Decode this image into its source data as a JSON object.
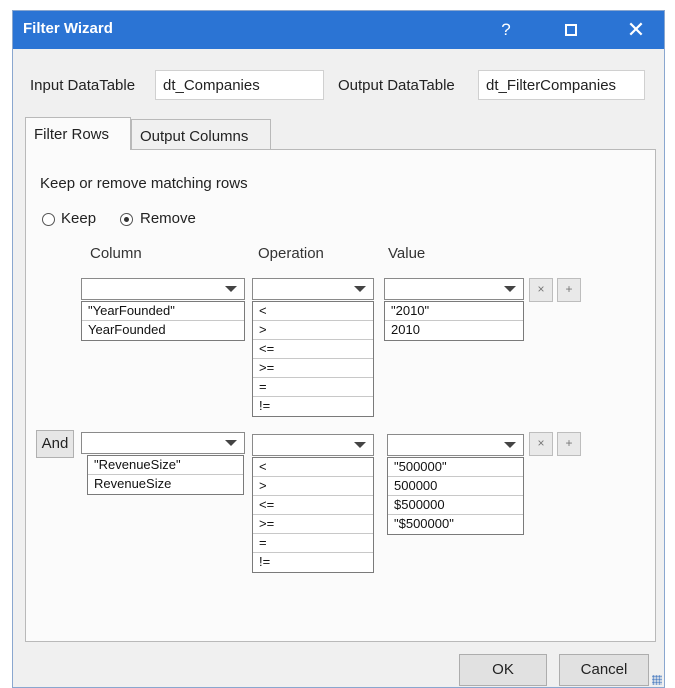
{
  "window": {
    "title": "Filter Wizard",
    "help_glyph": "?",
    "close_glyph": "✕"
  },
  "input_table": {
    "label": "Input DataTable",
    "value": "dt_Companies"
  },
  "output_table": {
    "label": "Output DataTable",
    "value": "dt_FilterCompanies"
  },
  "tabs": [
    {
      "label": "Filter Rows",
      "active": true
    },
    {
      "label": "Output Columns",
      "active": false
    }
  ],
  "filter": {
    "mode_label": "Keep or remove matching rows",
    "keep_label": "Keep",
    "remove_label": "Remove",
    "selected_mode": "Remove",
    "headers": {
      "column": "Column",
      "operation": "Operation",
      "value": "Value"
    },
    "remove_glyph": "×",
    "add_glyph": "+"
  },
  "rows": [
    {
      "column_options": [
        "\"YearFounded\"",
        "YearFounded"
      ],
      "operation_options": [
        "<",
        ">",
        "<=",
        ">=",
        "=",
        "!="
      ],
      "value_options": [
        "\"2010\"",
        "2010"
      ]
    },
    {
      "connector": "And",
      "column_options": [
        "\"RevenueSize\"",
        "RevenueSize"
      ],
      "operation_options": [
        "<",
        ">",
        "<=",
        ">=",
        "=",
        "!="
      ],
      "value_options": [
        "\"500000\"",
        "500000",
        "$500000",
        "\"$500000\""
      ]
    }
  ],
  "buttons": {
    "ok": "OK",
    "cancel": "Cancel"
  },
  "colors": {
    "titlebar": "#2b74d4",
    "dialog_bg": "#f0f0f0"
  }
}
